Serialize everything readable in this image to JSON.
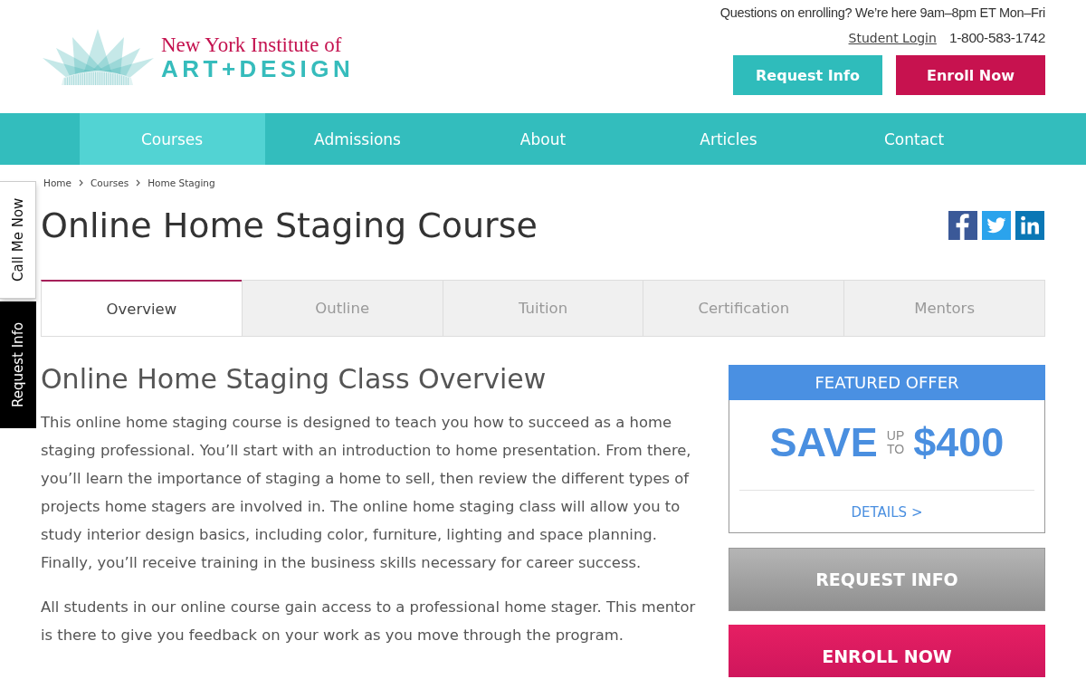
{
  "header": {
    "logo": {
      "top_line": "New York Institute of",
      "bottom_line": "ART+DESIGN"
    },
    "contact_note": "Questions on enrolling? We’re here 9am–8pm ET Mon–Fri",
    "student_login": "Student Login",
    "phone": "1-800-583-1742",
    "buttons": [
      {
        "label": "Request Info",
        "kind": "secondary"
      },
      {
        "label": "Enroll Now",
        "kind": "primary"
      }
    ]
  },
  "nav": [
    {
      "label": "Courses",
      "selected": true
    },
    {
      "label": "Admissions",
      "selected": false
    },
    {
      "label": "About",
      "selected": false
    },
    {
      "label": "Articles",
      "selected": false
    },
    {
      "label": "Contact",
      "selected": false
    }
  ],
  "side_tabs": [
    {
      "label": "Call Me Now",
      "kind": "light"
    },
    {
      "label": "Request Info",
      "kind": "dark"
    }
  ],
  "breadcrumb": [
    "Home",
    "Courses",
    "Home Staging"
  ],
  "page_title": "Online Home Staging Course",
  "share_buttons": [
    {
      "kind": "facebook"
    },
    {
      "kind": "twitter"
    },
    {
      "kind": "linkedin"
    }
  ],
  "tabs": [
    {
      "label": "Overview",
      "selected": true
    },
    {
      "label": "Outline",
      "selected": false
    },
    {
      "label": "Tuition",
      "selected": false
    },
    {
      "label": "Certification",
      "selected": false
    },
    {
      "label": "Mentors",
      "selected": false
    }
  ],
  "overview": {
    "heading": "Online Home Staging Class Overview",
    "paragraphs": [
      "This online home staging course is designed to teach you how to succeed as a home staging professional. You’ll start with an introduction to home presentation. From there, you’ll learn the importance of staging a home to sell, then review the different types of projects home stagers are involved in. The online home staging class will allow you to study interior design basics, including color, furniture, lighting and space planning. Finally, you’ll receive training in the business skills necessary for career success.",
      "All students in our online course gain access to a professional home stager. This mentor is there to give you feedback on your work as you move through the program."
    ]
  },
  "featured_offer": {
    "title": "FEATURED OFFER",
    "save": "SAVE",
    "up": "UP",
    "to": "TO",
    "amount": "$400",
    "details_link": "DETAILS >"
  },
  "sidebar_buttons": [
    {
      "label": "REQUEST INFO",
      "kind": "secondary"
    },
    {
      "label": "ENROLL NOW",
      "kind": "primary"
    }
  ]
}
